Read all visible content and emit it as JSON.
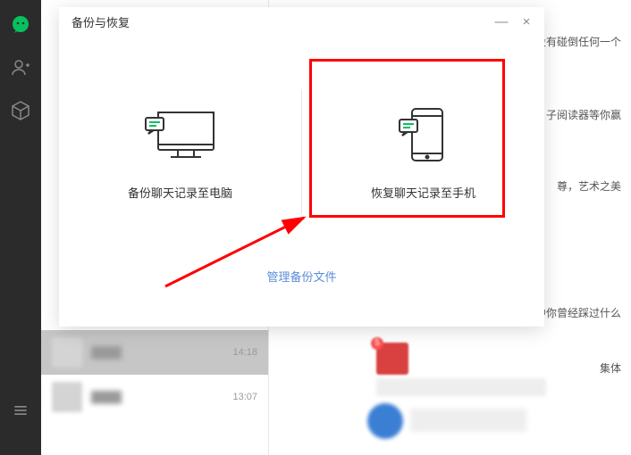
{
  "sidebar": {
    "chat_icon": "chat",
    "contacts_icon": "contacts",
    "favorites_icon": "favorites",
    "menu_icon": "menu"
  },
  "chatlist": {
    "items": [
      {
        "time": "14:18"
      },
      {
        "time": "13:07"
      }
    ]
  },
  "rightcol": {
    "snippet1": "然没有碰倒任何一个",
    "snippet2": "子阅读器等你赢",
    "snippet3": "尊，艺术之美",
    "snippet4": "程中你曾经踩过什么",
    "snippet5": "集体",
    "badge": "5"
  },
  "dialog": {
    "title": "备份与恢复",
    "minimize": "—",
    "close": "×",
    "option_backup": "备份聊天记录至电脑",
    "option_restore": "恢复聊天记录至手机",
    "footer_link": "管理备份文件"
  }
}
